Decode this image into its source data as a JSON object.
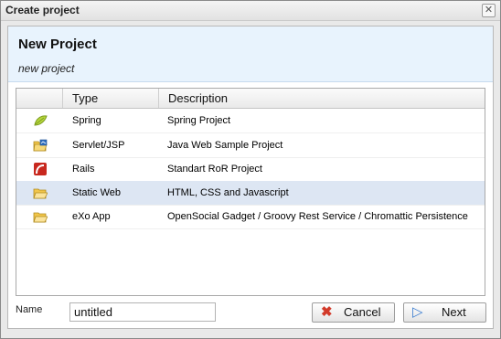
{
  "dialog": {
    "title": "Create project",
    "close_glyph": "✕"
  },
  "header": {
    "title": "New Project",
    "subtitle": "new project"
  },
  "table": {
    "columns": {
      "type": "Type",
      "description": "Description"
    },
    "rows": [
      {
        "icon": "leaf-icon",
        "type": "Spring",
        "description": "Spring Project",
        "selected": false
      },
      {
        "icon": "folder-java-icon",
        "type": "Servlet/JSP",
        "description": "Java Web Sample Project",
        "selected": false
      },
      {
        "icon": "rails-icon",
        "type": "Rails",
        "description": "Standart RoR Project",
        "selected": false
      },
      {
        "icon": "folder-open-icon",
        "type": "Static Web",
        "description": "HTML, CSS and Javascript",
        "selected": true
      },
      {
        "icon": "folder-open-icon",
        "type": "eXo App",
        "description": "OpenSocial Gadget / Groovy Rest Service / Chromattic Persistence",
        "selected": false
      }
    ]
  },
  "footer": {
    "name_label": "Name",
    "name_value": "untitled",
    "cancel_label": "Cancel",
    "next_label": "Next",
    "cancel_glyph": "✖",
    "next_glyph": "▷"
  },
  "colors": {
    "header_bg": "#e8f3fd",
    "selected_row": "#dde6f3",
    "cancel_icon": "#d23a2a",
    "next_icon": "#3f7fd0"
  }
}
